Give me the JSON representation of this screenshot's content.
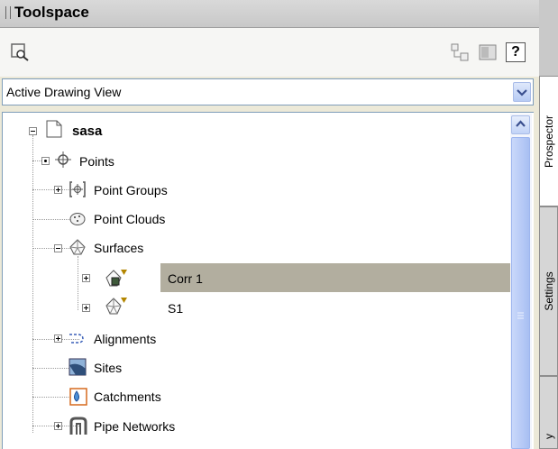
{
  "window": {
    "title": "Toolspace"
  },
  "toolbar": {
    "buttons": [
      "search-icon",
      "structure-icon",
      "panel-icon",
      "help-icon"
    ],
    "help_label": "?"
  },
  "view_select": {
    "value": "Active Drawing View"
  },
  "tree": {
    "root": "sasa",
    "items": [
      {
        "label": "Points"
      },
      {
        "label": "Point Groups"
      },
      {
        "label": "Point Clouds"
      },
      {
        "label": "Surfaces"
      },
      {
        "label": "Corr 1",
        "selected": true
      },
      {
        "label": "S1"
      },
      {
        "label": "Alignments"
      },
      {
        "label": "Sites"
      },
      {
        "label": "Catchments"
      },
      {
        "label": "Pipe Networks"
      }
    ]
  },
  "tabs": [
    {
      "label": "Prospector",
      "active": true
    },
    {
      "label": "Settings"
    },
    {
      "label": "y"
    }
  ],
  "colors": {
    "selection": "#b2ae9f",
    "accent": "#c7d6f8"
  }
}
